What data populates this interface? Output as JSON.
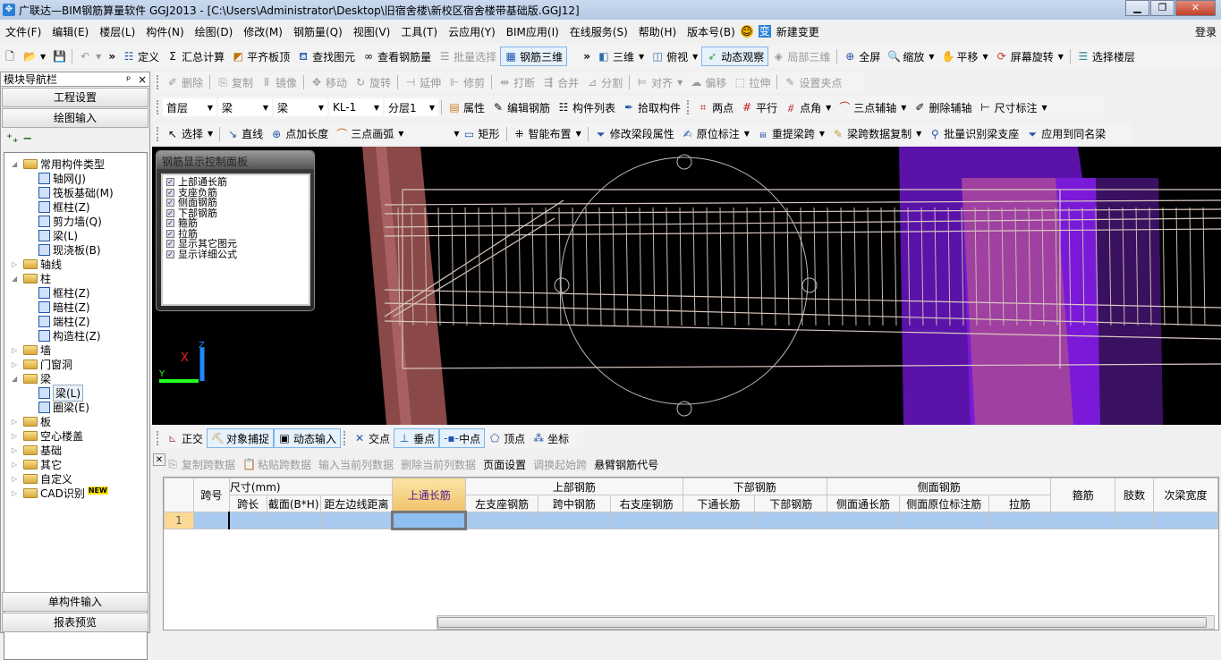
{
  "window": {
    "title": "广联达—BIM钢筋算量软件 GGJ2013 - [C:\\Users\\Administrator\\Desktop\\旧宿舍楼\\新校区宿舍楼带基础版.GGJ12]",
    "min": "▁",
    "max": "❐",
    "close": "✕"
  },
  "menu": {
    "items": [
      "文件(F)",
      "编辑(E)",
      "楼层(L)",
      "构件(N)",
      "绘图(D)",
      "修改(M)",
      "钢筋量(Q)",
      "视图(V)",
      "工具(T)",
      "云应用(Y)",
      "BIM应用(I)",
      "在线服务(S)",
      "帮助(H)",
      "版本号(B)"
    ],
    "new_change": "新建变更",
    "login": "登录"
  },
  "toolbar1": {
    "items": [
      "定义",
      "汇总计算",
      "平齐板顶",
      "查找图元",
      "查看钢筋量",
      "批量选择",
      "钢筋三维"
    ],
    "right": [
      "三维",
      "俯视",
      "动态观察",
      "局部三维",
      "全屏",
      "缩放",
      "平移",
      "屏幕旋转",
      "选择楼层"
    ]
  },
  "toolbar2": {
    "items": [
      "删除",
      "复制",
      "镜像",
      "移动",
      "旋转",
      "延伸",
      "修剪",
      "打断",
      "合并",
      "分割",
      "对齐",
      "偏移",
      "拉伸",
      "设置夹点"
    ]
  },
  "toolbar3": {
    "floor": "首层",
    "type1": "梁",
    "type2": "梁",
    "component": "KL-1",
    "layer": "分层1",
    "items": [
      "属性",
      "编辑钢筋",
      "构件列表",
      "拾取构件",
      "两点",
      "平行",
      "点角",
      "三点辅轴",
      "删除辅轴",
      "尺寸标注"
    ]
  },
  "toolbar4": {
    "items": [
      "选择",
      "直线",
      "点加长度",
      "三点画弧",
      "矩形",
      "智能布置",
      "修改梁段属性",
      "原位标注",
      "重提梁跨",
      "梁跨数据复制",
      "批量识别梁支座",
      "应用到同名梁"
    ]
  },
  "nav": {
    "title": "模块导航栏",
    "pin": "ᵖ",
    "close": "×",
    "btn_project": "工程设置",
    "btn_draw": "绘图输入",
    "btn_single": "单构件输入",
    "btn_report": "报表预览",
    "tree": [
      {
        "label": "常用构件类型",
        "level": 0,
        "folder": true,
        "open": true
      },
      {
        "label": "轴网(J)",
        "level": 1
      },
      {
        "label": "筏板基础(M)",
        "level": 1
      },
      {
        "label": "框柱(Z)",
        "level": 1
      },
      {
        "label": "剪力墙(Q)",
        "level": 1
      },
      {
        "label": "梁(L)",
        "level": 1
      },
      {
        "label": "现浇板(B)",
        "level": 1
      },
      {
        "label": "轴线",
        "level": 0,
        "folder": true
      },
      {
        "label": "柱",
        "level": 0,
        "folder": true,
        "open": true
      },
      {
        "label": "框柱(Z)",
        "level": 1
      },
      {
        "label": "暗柱(Z)",
        "level": 1
      },
      {
        "label": "端柱(Z)",
        "level": 1
      },
      {
        "label": "构造柱(Z)",
        "level": 1
      },
      {
        "label": "墙",
        "level": 0,
        "folder": true
      },
      {
        "label": "门窗洞",
        "level": 0,
        "folder": true
      },
      {
        "label": "梁",
        "level": 0,
        "folder": true,
        "open": true
      },
      {
        "label": "梁(L)",
        "level": 1,
        "selected": true
      },
      {
        "label": "圈梁(E)",
        "level": 1
      },
      {
        "label": "板",
        "level": 0,
        "folder": true
      },
      {
        "label": "空心楼盖",
        "level": 0,
        "folder": true
      },
      {
        "label": "基础",
        "level": 0,
        "folder": true
      },
      {
        "label": "其它",
        "level": 0,
        "folder": true
      },
      {
        "label": "自定义",
        "level": 0,
        "folder": true
      },
      {
        "label": "CAD识别",
        "level": 0,
        "folder": true,
        "badge": "NEW"
      }
    ]
  },
  "rebar_panel": {
    "title": "钢筋显示控制面板",
    "items": [
      {
        "label": "上部通长筋",
        "checked": true
      },
      {
        "label": "支座负筋",
        "checked": true
      },
      {
        "label": "侧面钢筋",
        "checked": true
      },
      {
        "label": "下部钢筋",
        "checked": true
      },
      {
        "label": "箍筋",
        "checked": true
      },
      {
        "label": "拉筋",
        "checked": true
      },
      {
        "label": "显示其它图元",
        "checked": true
      },
      {
        "label": "显示详细公式",
        "checked": true
      }
    ]
  },
  "axes": {
    "x": "X",
    "y": "Y",
    "z": "Z"
  },
  "snapbar": {
    "items": [
      "正交",
      "对象捕捉",
      "动态输入",
      "交点",
      "垂点",
      "中点",
      "顶点",
      "坐标"
    ]
  },
  "tablebar": {
    "items": [
      "复制跨数据",
      "粘贴跨数据",
      "输入当前列数据",
      "删除当前列数据",
      "页面设置",
      "调换起始跨",
      "悬臂钢筋代号"
    ]
  },
  "grid": {
    "span": "跨号",
    "size": "尺寸(mm)",
    "span_len": "跨长",
    "section": "截面(B*H)",
    "dist": "距左边线距离",
    "top_through": "上通长筋",
    "top": "上部钢筋",
    "top_sub": [
      "左支座钢筋",
      "跨中钢筋",
      "右支座钢筋"
    ],
    "bottom": "下部钢筋",
    "bottom_sub": [
      "下通长筋",
      "下部钢筋"
    ],
    "side": "侧面钢筋",
    "side_sub": [
      "侧面通长筋",
      "侧面原位标注筋",
      "拉筋"
    ],
    "stirrup": "箍筋",
    "legs": "肢数",
    "sec_width": "次梁宽度",
    "rows": [
      {
        "num": "1"
      }
    ]
  }
}
